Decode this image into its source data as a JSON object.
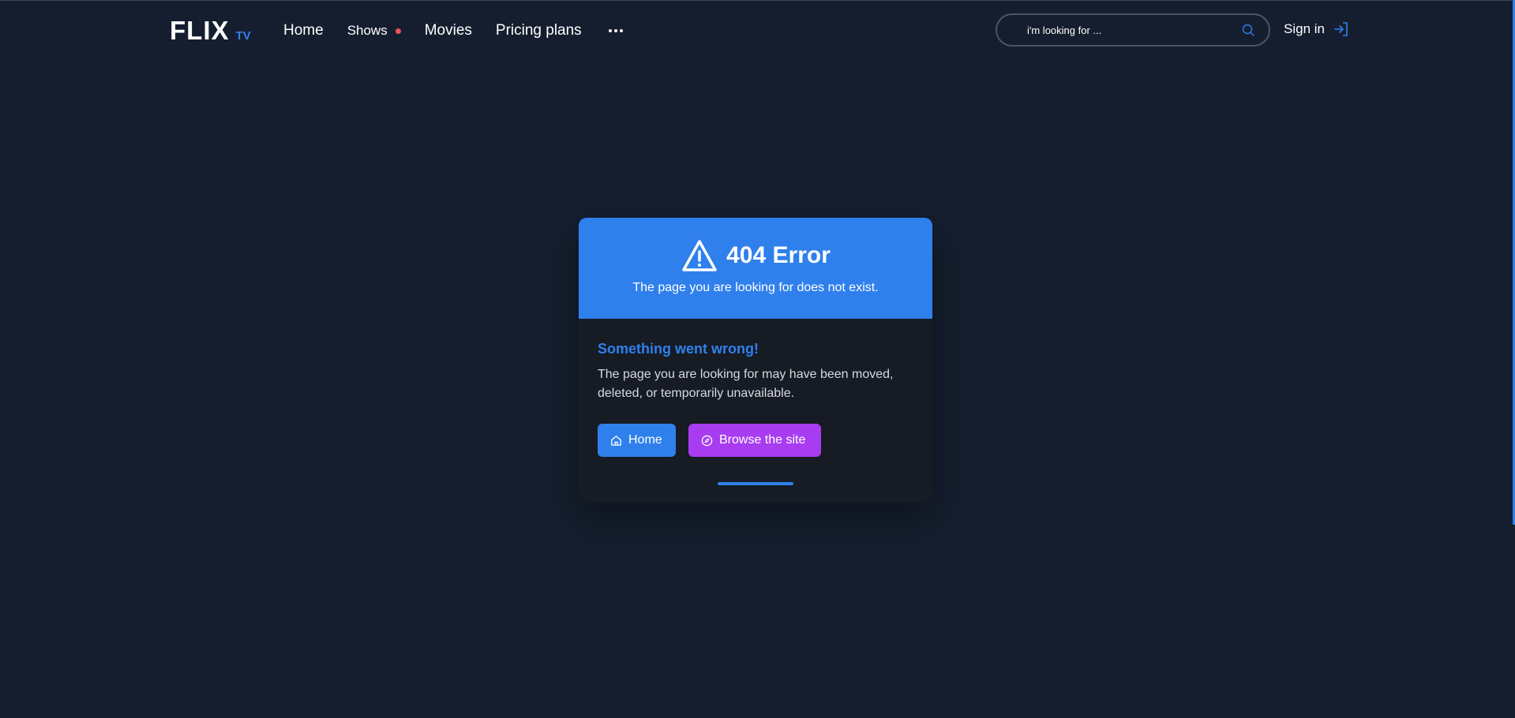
{
  "header": {
    "logo_main": "FLIX",
    "logo_sub": "TV",
    "nav": {
      "home": "Home",
      "shows": "Shows",
      "movies": "Movies",
      "pricing": "Pricing plans"
    },
    "search": {
      "placeholder": "i'm looking for ..."
    },
    "signin": "Sign in"
  },
  "error_card": {
    "title": "404 Error",
    "subtitle": "The page you are looking for does not exist.",
    "heading": "Something went wrong!",
    "description": "The page you are looking for may have been moved, deleted, or temporarily unavailable.",
    "home_button": "Home",
    "browse_button": "Browse the site",
    "progress": 1.0
  },
  "colors": {
    "background": "#151e2e",
    "accent": "#2f80ed",
    "browse": "#a83cf0",
    "notification_dot": "#eb5757"
  },
  "icons": {
    "search": "search-icon",
    "signin": "sign-in-icon",
    "warning": "warning-triangle-icon",
    "home": "home-icon",
    "browse": "compass-icon",
    "more": "more-dots-icon"
  }
}
